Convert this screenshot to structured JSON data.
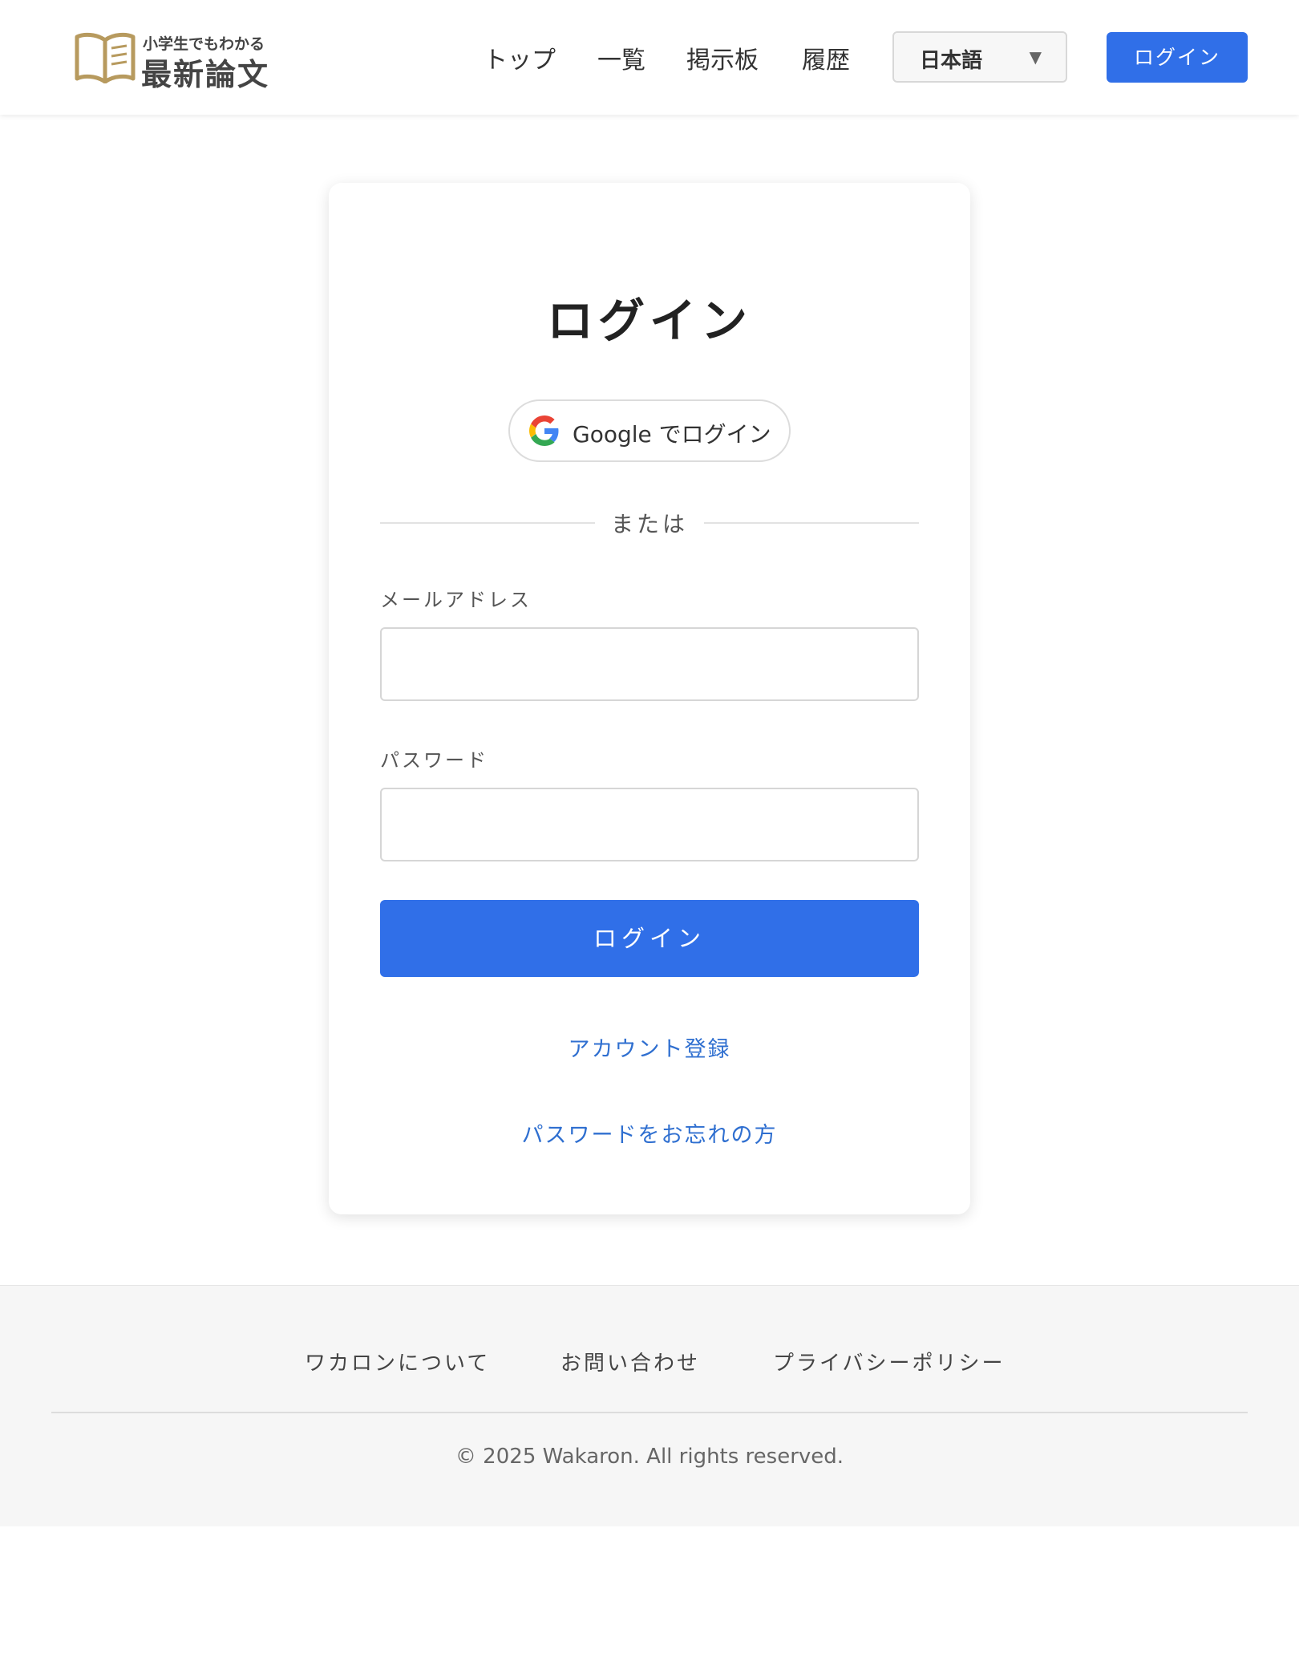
{
  "header": {
    "logo": {
      "tagline": "小学生でもわかる",
      "name": "最新論文"
    },
    "nav": [
      {
        "label": "トップ"
      },
      {
        "label": "一覧"
      },
      {
        "label": "掲示板"
      },
      {
        "label": "履歴"
      }
    ],
    "language": {
      "selected": "日本語",
      "caret": "▼"
    },
    "login_button": "ログイン"
  },
  "login": {
    "title": "ログイン",
    "google_button": "Google でログイン",
    "divider": "または",
    "email_label": "メールアドレス",
    "email_value": "",
    "password_label": "パスワード",
    "password_value": "",
    "submit": "ログイン",
    "register_link": "アカウント登録",
    "forgot_link": "パスワードをお忘れの方"
  },
  "footer": {
    "links": [
      {
        "label": "ワカロンについて"
      },
      {
        "label": "お問い合わせ"
      },
      {
        "label": "プライバシーポリシー"
      }
    ],
    "copyright": "© 2025 Wakaron. All rights reserved."
  },
  "colors": {
    "primary": "#306fe8",
    "link": "#2f6fd0",
    "logo": "#b79a5e",
    "footer_bg": "#f6f6f6"
  }
}
